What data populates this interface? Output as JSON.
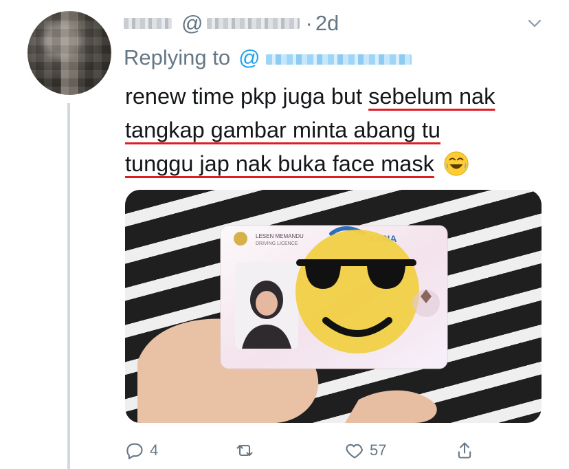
{
  "tweet": {
    "handle_prefix": "@",
    "separator": "·",
    "time": "2d",
    "replying_to": "Replying to",
    "reply_mention_prefix": "@",
    "text": {
      "plain_before": "renew time pkp juga but ",
      "underlined_1": "sebelum nak",
      "underlined_2": "tangkap gambar minta abang tu",
      "underlined_3": "tunggu jap nak buka face mask",
      "emoji": "😂"
    }
  },
  "actions": {
    "reply_count": "4",
    "retweet_count": "",
    "like_count": "57"
  },
  "icons": {
    "reply": "reply-icon",
    "retweet": "retweet-icon",
    "like": "heart-icon",
    "share": "share-icon",
    "caret": "chevron-down-icon"
  },
  "media": {
    "card_brand_text": "AYSIA",
    "card_title_line1": "LESEN MEMANDU",
    "card_title_line2": "DRIVING LICENCE"
  }
}
